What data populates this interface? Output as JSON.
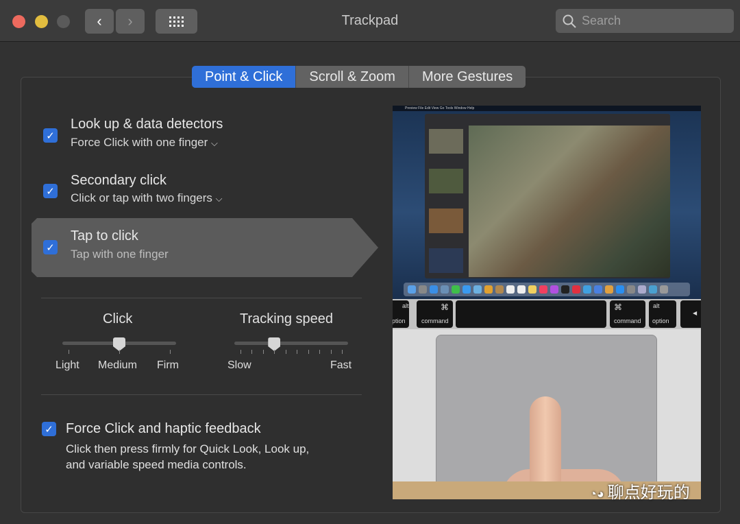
{
  "window": {
    "title": "Trackpad",
    "search_placeholder": "Search"
  },
  "colors": {
    "accent": "#2f6fd8",
    "close": "#ed6a5e",
    "minimize": "#e2bd3f",
    "zoom_disabled": "#5a5a5a"
  },
  "tabs": [
    {
      "label": "Point & Click",
      "active": true
    },
    {
      "label": "Scroll & Zoom",
      "active": false
    },
    {
      "label": "More Gestures",
      "active": false
    }
  ],
  "options": [
    {
      "title": "Look up & data detectors",
      "subtitle": "Force Click with one finger",
      "checked": true,
      "has_dropdown": true
    },
    {
      "title": "Secondary click",
      "subtitle": "Click or tap with two fingers",
      "checked": true,
      "has_dropdown": true
    },
    {
      "title": "Tap to click",
      "subtitle": "Tap with one finger",
      "checked": true,
      "selected": true
    }
  ],
  "click_slider": {
    "label": "Click",
    "ticks": [
      "Light",
      "Medium",
      "Firm"
    ],
    "value": "Medium",
    "position": 0.5
  },
  "tracking_slider": {
    "label": "Tracking speed",
    "min_label": "Slow",
    "max_label": "Fast",
    "tick_count": 10,
    "position": 0.333
  },
  "force_click": {
    "title": "Force Click and haptic feedback",
    "description_line1": "Click then press firmly for Quick Look, Look up,",
    "description_line2": "and variable speed media controls.",
    "checked": true
  },
  "preview": {
    "menu": "Preview  File  Edit  View  Go  Tools  Window  Help",
    "keys": {
      "alt": "alt",
      "option": "option",
      "command": "command",
      "cmd_symbol": "⌘"
    }
  },
  "watermark": "聊点好玩的"
}
